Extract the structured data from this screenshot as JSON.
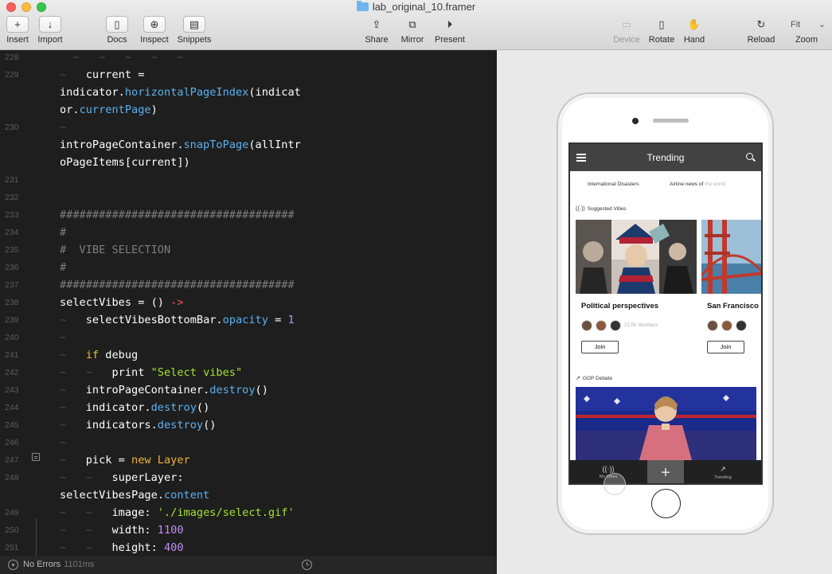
{
  "window": {
    "title": "lab_original_10.framer"
  },
  "toolbar": {
    "insert": "Insert",
    "import": "Import",
    "docs": "Docs",
    "inspect": "Inspect",
    "snippets": "Snippets",
    "share": "Share",
    "mirror": "Mirror",
    "present": "Present",
    "device": "Device",
    "rotate": "Rotate",
    "hand": "Hand",
    "reload": "Reload",
    "zoom_value": "Fit",
    "zoom": "Zoom"
  },
  "editor": {
    "lines": [
      {
        "n": "228",
        "segs": [
          [
            "ws",
            "  ~   ~   ~   ~   ~"
          ]
        ]
      },
      {
        "n": "229",
        "segs": [
          [
            "ws",
            "~   "
          ],
          [
            "tx",
            "current ="
          ]
        ]
      },
      {
        "n": "",
        "segs": [
          [
            "tx",
            "indicator."
          ],
          [
            "fn",
            "horizontalPageIndex"
          ],
          [
            "tx",
            "(indicat"
          ]
        ]
      },
      {
        "n": "",
        "segs": [
          [
            "tx",
            "or."
          ],
          [
            "fn",
            "currentPage"
          ],
          [
            "tx",
            ")"
          ]
        ]
      },
      {
        "n": "230",
        "segs": [
          [
            "ws",
            "~"
          ]
        ]
      },
      {
        "n": "",
        "segs": [
          [
            "tx",
            "introPageContainer."
          ],
          [
            "fn",
            "snapToPage"
          ],
          [
            "tx",
            "(allIntr"
          ]
        ]
      },
      {
        "n": "",
        "segs": [
          [
            "tx",
            "oPageItems[current])"
          ]
        ]
      },
      {
        "n": "231",
        "segs": []
      },
      {
        "n": "232",
        "segs": []
      },
      {
        "n": "233",
        "segs": [
          [
            "cm",
            "####################################"
          ]
        ]
      },
      {
        "n": "234",
        "segs": [
          [
            "cm",
            "#"
          ]
        ]
      },
      {
        "n": "235",
        "segs": [
          [
            "cm",
            "#  VIBE SELECTION"
          ]
        ]
      },
      {
        "n": "236",
        "segs": [
          [
            "cm",
            "#"
          ]
        ]
      },
      {
        "n": "237",
        "segs": [
          [
            "cm",
            "####################################"
          ]
        ]
      },
      {
        "n": "238",
        "segs": [
          [
            "tx",
            "selectVibes = () "
          ],
          [
            "op",
            "->"
          ]
        ]
      },
      {
        "n": "239",
        "segs": [
          [
            "ws",
            "~   "
          ],
          [
            "tx",
            "selectVibesBottomBar."
          ],
          [
            "fn",
            "opacity"
          ],
          [
            "tx",
            " = "
          ],
          [
            "num",
            "1"
          ]
        ]
      },
      {
        "n": "240",
        "segs": [
          [
            "ws",
            "~"
          ]
        ]
      },
      {
        "n": "241",
        "segs": [
          [
            "ws",
            "~   "
          ],
          [
            "kw",
            "if"
          ],
          [
            "tx",
            " debug"
          ]
        ]
      },
      {
        "n": "242",
        "segs": [
          [
            "ws",
            "~   ~   "
          ],
          [
            "tx",
            "print "
          ],
          [
            "str",
            "\"Select vibes\""
          ]
        ]
      },
      {
        "n": "243",
        "segs": [
          [
            "ws",
            "~   "
          ],
          [
            "tx",
            "introPageContainer."
          ],
          [
            "fn",
            "destroy"
          ],
          [
            "tx",
            "()"
          ]
        ]
      },
      {
        "n": "244",
        "segs": [
          [
            "ws",
            "~   "
          ],
          [
            "tx",
            "indicator."
          ],
          [
            "fn",
            "destroy"
          ],
          [
            "tx",
            "()"
          ]
        ]
      },
      {
        "n": "245",
        "segs": [
          [
            "ws",
            "~   "
          ],
          [
            "tx",
            "indicators."
          ],
          [
            "fn",
            "destroy"
          ],
          [
            "tx",
            "()"
          ]
        ]
      },
      {
        "n": "246",
        "segs": [
          [
            "ws",
            "~"
          ]
        ]
      },
      {
        "n": "247",
        "segs": [
          [
            "ws",
            "~   "
          ],
          [
            "tx",
            "pick = "
          ],
          [
            "kw",
            "new Layer"
          ]
        ]
      },
      {
        "n": "248",
        "segs": [
          [
            "ws",
            "~   ~   "
          ],
          [
            "tx",
            "superLayer:"
          ]
        ]
      },
      {
        "n": "",
        "segs": [
          [
            "tx",
            "selectVibesPage."
          ],
          [
            "fn",
            "content"
          ]
        ]
      },
      {
        "n": "249",
        "segs": [
          [
            "ws",
            "~   ~   "
          ],
          [
            "tx",
            "image: "
          ],
          [
            "str",
            "'./images/select.gif'"
          ]
        ]
      },
      {
        "n": "250",
        "segs": [
          [
            "ws",
            "~   ~   "
          ],
          [
            "tx",
            "width: "
          ],
          [
            "num",
            "1100"
          ]
        ]
      },
      {
        "n": "251",
        "segs": [
          [
            "ws",
            "~   ~   "
          ],
          [
            "tx",
            "height: "
          ],
          [
            "num",
            "400"
          ]
        ]
      }
    ]
  },
  "status": {
    "text": "No Errors",
    "time": "1101ms"
  },
  "app": {
    "title": "Trending",
    "categories": [
      "International Disasters",
      "Airline news of",
      " the world"
    ],
    "suggested_label": "Suggested Vibes",
    "cards": [
      {
        "title": "Political perspectives",
        "members": "21.5K Members",
        "join": "Join"
      },
      {
        "title": "San Francisco",
        "members": "",
        "join": "Join"
      }
    ],
    "debate_label": "GOP Debate",
    "tabs": {
      "my_vibes": "My Vibes",
      "add": "+",
      "trending": "Trending"
    }
  },
  "colors": {
    "editor_bg": "#1e1e1e",
    "function": "#5ab2f2",
    "keyword": "#f3b43a",
    "number": "#c08cf7",
    "string": "#a6e22e",
    "arrow": "#ee5a52",
    "comment": "#7d7d7d"
  }
}
